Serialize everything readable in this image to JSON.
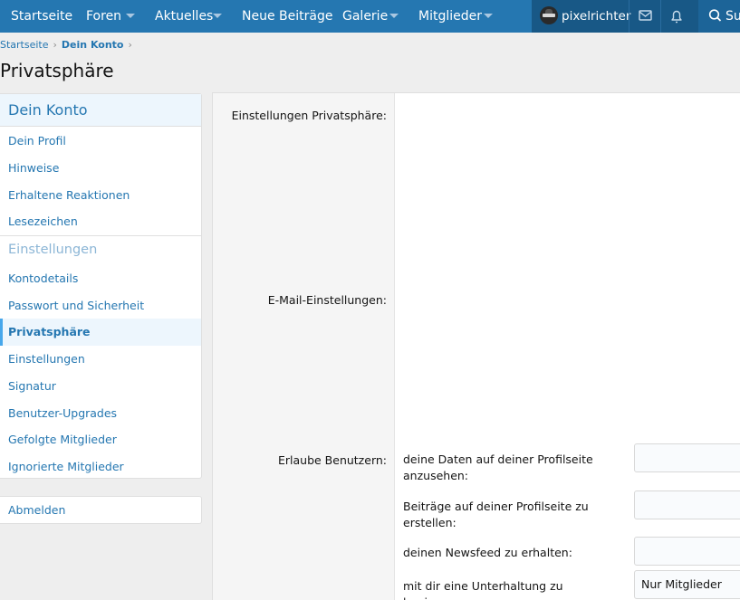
{
  "nav": {
    "items": [
      {
        "label": "Startseite",
        "has_menu": false
      },
      {
        "label": "Foren",
        "has_menu": true
      },
      {
        "label": "Aktuelles",
        "has_menu": true
      },
      {
        "label": "Neue Beiträge",
        "has_menu": false
      },
      {
        "label": "Galerie",
        "has_menu": true
      },
      {
        "label": "Mitglieder",
        "has_menu": true
      }
    ],
    "username": "pixelrichter",
    "search_label": "Suchen",
    "icons": {
      "inbox": "envelope-icon",
      "alerts": "bell-icon",
      "search": "search-icon"
    }
  },
  "breadcrumb": {
    "home": "Startseite",
    "account": "Dein Konto"
  },
  "page_title": "Privatsphäre",
  "sidebar": {
    "heading": "Dein Konto",
    "section_label": "Einstellungen",
    "items": [
      {
        "label": "Dein Profil",
        "active": false
      },
      {
        "label": "Hinweise",
        "active": false
      },
      {
        "label": "Erhaltene Reaktionen",
        "active": false
      },
      {
        "label": "Lesezeichen",
        "active": false
      },
      {
        "label": "Kontodetails",
        "active": false
      },
      {
        "label": "Passwort und Sicherheit",
        "active": false
      },
      {
        "label": "Privatsphäre",
        "active": true
      },
      {
        "label": "Einstellungen",
        "active": false
      },
      {
        "label": "Signatur",
        "active": false
      },
      {
        "label": "Benutzer-Upgrades",
        "active": false
      },
      {
        "label": "Gefolgte Mitglieder",
        "active": false
      },
      {
        "label": "Ignorierte Mitglieder",
        "active": false
      }
    ],
    "logout": "Abmelden"
  },
  "form": {
    "privacy_label": "Einstellungen Privatsphäre:",
    "email_label": "E-Mail-Einstellungen:",
    "allow_label": "Erlaube Benutzern:",
    "options": [
      {
        "text": "deine Daten auf deiner Profilseite anzusehen:",
        "value": ""
      },
      {
        "text": "Beiträge auf deiner Profilseite zu erstellen:",
        "value": ""
      },
      {
        "text": "deinen Newsfeed zu erhalten:",
        "value": ""
      },
      {
        "text": "mit dir eine Unterhaltung zu beginnen:",
        "value": "Nur Mitglieder"
      }
    ]
  },
  "colors": {
    "nav_bg": "#2577b1",
    "nav_dark": "#185886",
    "link": "#2577b1",
    "active_bg": "#edf6fd"
  }
}
